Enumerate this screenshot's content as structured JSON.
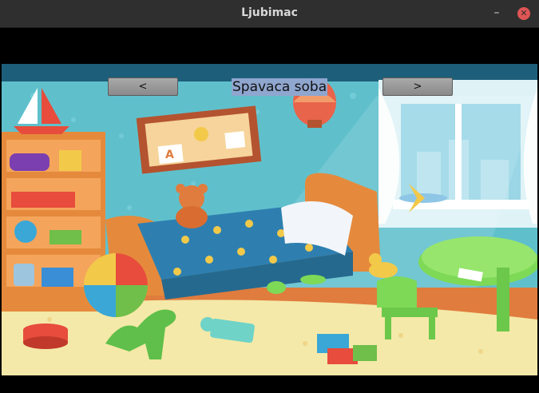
{
  "window": {
    "title": "Ljubimac"
  },
  "controls": {
    "minimize": "–",
    "close": "✕"
  },
  "room": {
    "name": "Spavaca soba"
  },
  "nav": {
    "prev_label": "<",
    "next_label": ">"
  },
  "drawing": {
    "letter_a": "A"
  }
}
